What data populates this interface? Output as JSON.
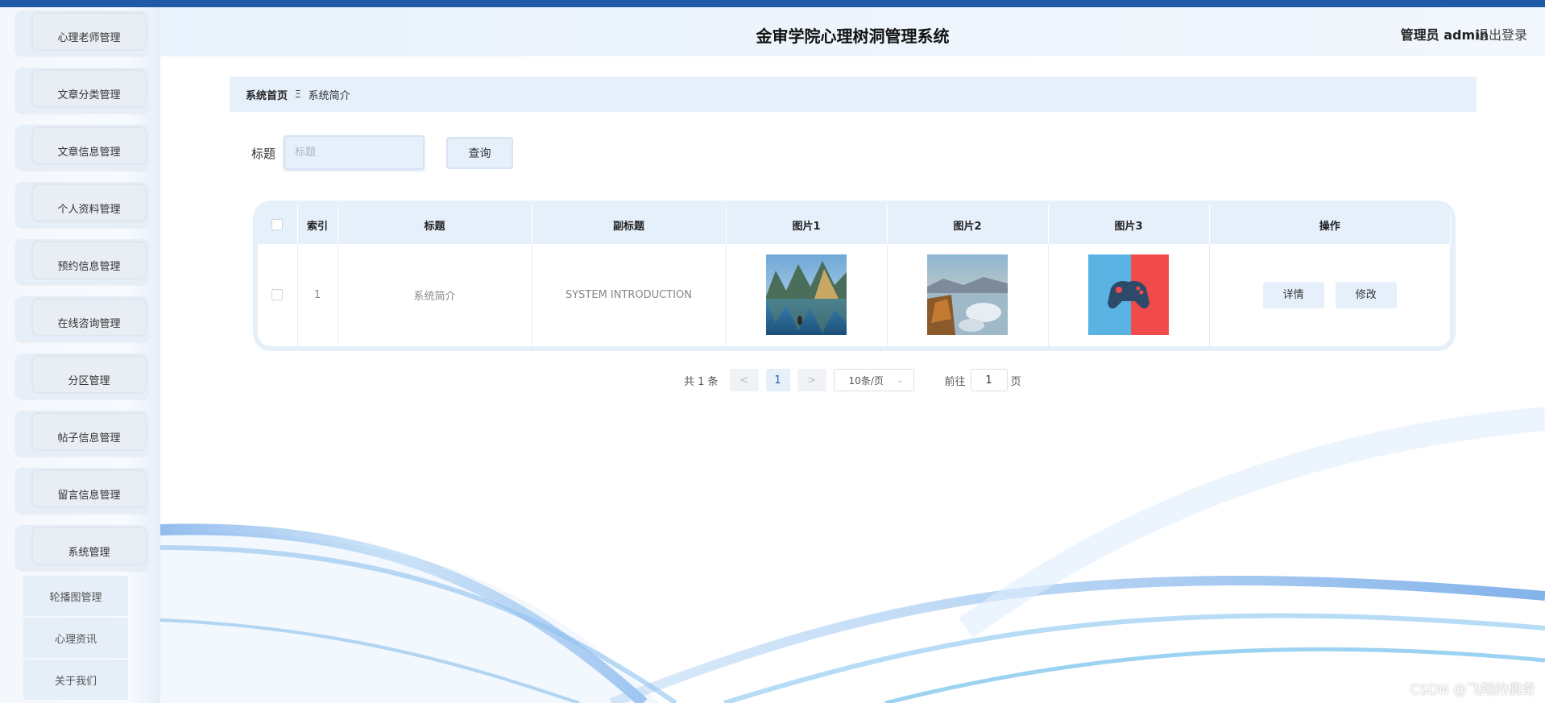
{
  "header": {
    "title": "金审学院心理树洞管理系统",
    "user": "管理员 admin",
    "logout": "退出登录"
  },
  "sidebar": {
    "items": [
      {
        "label": "心理老师管理"
      },
      {
        "label": "文章分类管理"
      },
      {
        "label": "文章信息管理"
      },
      {
        "label": "个人资料管理"
      },
      {
        "label": "预约信息管理"
      },
      {
        "label": "在线咨询管理"
      },
      {
        "label": "分区管理"
      },
      {
        "label": "帖子信息管理"
      },
      {
        "label": "留言信息管理"
      },
      {
        "label": "系统管理"
      }
    ],
    "sub_items": [
      {
        "label": "轮播图管理"
      },
      {
        "label": "心理资讯"
      },
      {
        "label": "关于我们"
      }
    ]
  },
  "breadcrumb": {
    "home": "系统首页",
    "separator": "Ξ",
    "current": "系统简介"
  },
  "search": {
    "label": "标题",
    "placeholder": "标题",
    "button": "查询"
  },
  "table": {
    "headers": [
      "索引",
      "标题",
      "副标题",
      "图片1",
      "图片2",
      "图片3",
      "操作"
    ],
    "rows": [
      {
        "index": "1",
        "title": "系统简介",
        "subtitle": "SYSTEM INTRODUCTION",
        "image1": "mountain-lake-image",
        "image2": "coastal-rocks-image",
        "image3": "gamepad-icon-image",
        "actions": [
          "详情",
          "修改"
        ]
      }
    ]
  },
  "pagination": {
    "total": "共 1 条",
    "prev": "<",
    "current_page": "1",
    "next": ">",
    "page_size": "10条/页",
    "jump_label": "前往",
    "jump_value": "1",
    "jump_suffix": "页"
  },
  "watermark": "CSDN @飞翔的佩奇",
  "colors": {
    "topbar": "#1f5aa6",
    "accent_light": "#e6f0fb"
  }
}
